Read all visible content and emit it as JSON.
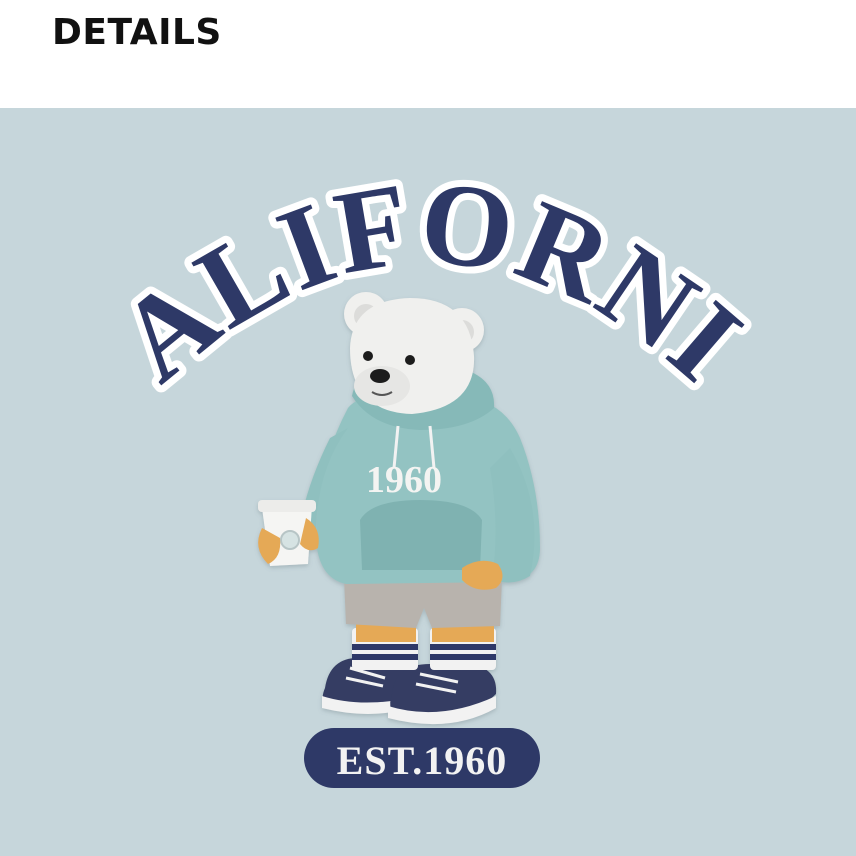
{
  "header": {
    "title": "DETAILS"
  },
  "graphic": {
    "arc_text": "CALIFORNIA",
    "hoodie_text": "1960",
    "badge_text": "EST.1960"
  },
  "colors": {
    "fabric": "#c6d6db",
    "navy": "#2e3967",
    "hoodie": "#93c3c2",
    "shorts": "#b8b3ad",
    "paw": "#e8a85a",
    "bear_white": "#f0f0ee"
  }
}
